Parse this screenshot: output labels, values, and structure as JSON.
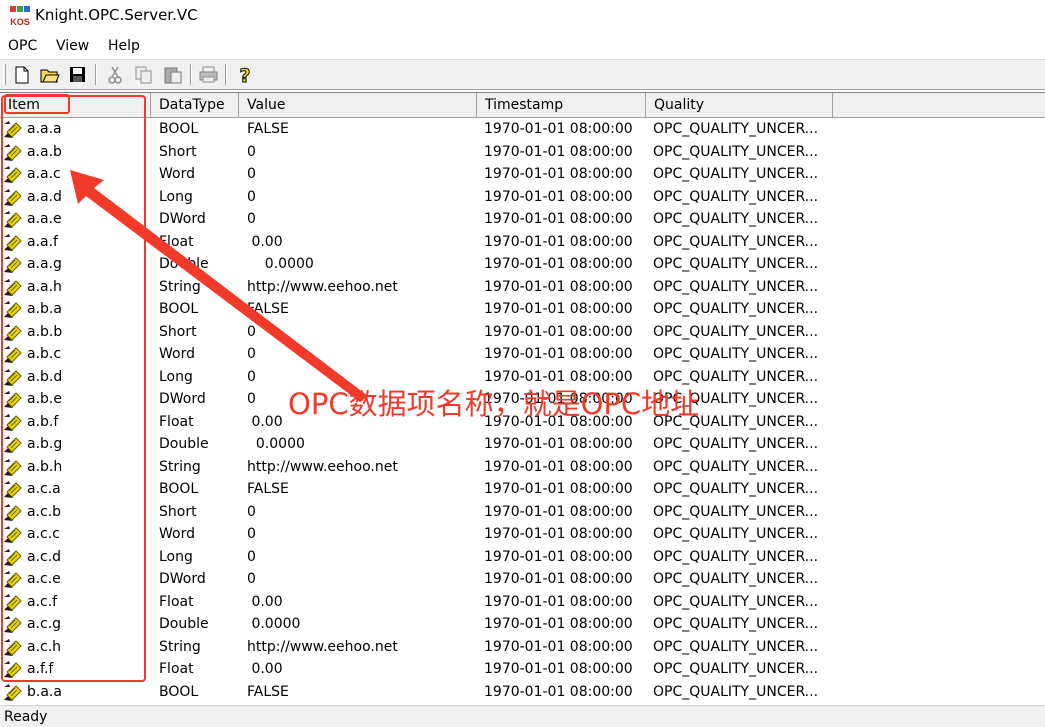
{
  "window": {
    "title": "Knight.OPC.Server.VC",
    "icon_label": "KOS"
  },
  "menu": {
    "items": [
      "OPC",
      "View",
      "Help"
    ]
  },
  "toolbar": {
    "buttons": [
      "new-file-icon",
      "open-folder-icon",
      "save-icon",
      "cut-icon",
      "copy-icon",
      "paste-icon",
      "print-icon",
      "help-icon"
    ]
  },
  "columns": [
    "Item",
    "DataType",
    "Value",
    "Timestamp",
    "Quality"
  ],
  "rows": [
    {
      "item": "a.a.a",
      "type": "BOOL",
      "value": "FALSE",
      "ts": "1970-01-01 08:00:00",
      "quality": "OPC_QUALITY_UNCER..."
    },
    {
      "item": "a.a.b",
      "type": "Short",
      "value": "0",
      "ts": "1970-01-01 08:00:00",
      "quality": "OPC_QUALITY_UNCER..."
    },
    {
      "item": "a.a.c",
      "type": "Word",
      "value": "0",
      "ts": "1970-01-01 08:00:00",
      "quality": "OPC_QUALITY_UNCER..."
    },
    {
      "item": "a.a.d",
      "type": "Long",
      "value": "0",
      "ts": "1970-01-01 08:00:00",
      "quality": "OPC_QUALITY_UNCER..."
    },
    {
      "item": "a.a.e",
      "type": "DWord",
      "value": "0",
      "ts": "1970-01-01 08:00:00",
      "quality": "OPC_QUALITY_UNCER..."
    },
    {
      "item": "a.a.f",
      "type": "Float",
      "value": " 0.00",
      "ts": "1970-01-01 08:00:00",
      "quality": "OPC_QUALITY_UNCER..."
    },
    {
      "item": "a.a.g",
      "type": "Double",
      "value": "    0.0000",
      "ts": "1970-01-01 08:00:00",
      "quality": "OPC_QUALITY_UNCER..."
    },
    {
      "item": "a.a.h",
      "type": "String",
      "value": "http://www.eehoo.net",
      "ts": "1970-01-01 08:00:00",
      "quality": "OPC_QUALITY_UNCER..."
    },
    {
      "item": "a.b.a",
      "type": "BOOL",
      "value": "FALSE",
      "ts": "1970-01-01 08:00:00",
      "quality": "OPC_QUALITY_UNCER..."
    },
    {
      "item": "a.b.b",
      "type": "Short",
      "value": "0",
      "ts": "1970-01-01 08:00:00",
      "quality": "OPC_QUALITY_UNCER..."
    },
    {
      "item": "a.b.c",
      "type": "Word",
      "value": "0",
      "ts": "1970-01-01 08:00:00",
      "quality": "OPC_QUALITY_UNCER..."
    },
    {
      "item": "a.b.d",
      "type": "Long",
      "value": "0",
      "ts": "1970-01-01 08:00:00",
      "quality": "OPC_QUALITY_UNCER..."
    },
    {
      "item": "a.b.e",
      "type": "DWord",
      "value": "0",
      "ts": "1970-01-01 08:00:00",
      "quality": "OPC_QUALITY_UNCER..."
    },
    {
      "item": "a.b.f",
      "type": "Float",
      "value": " 0.00",
      "ts": "1970-01-01 08:00:00",
      "quality": "OPC_QUALITY_UNCER..."
    },
    {
      "item": "a.b.g",
      "type": "Double",
      "value": "  0.0000",
      "ts": "1970-01-01 08:00:00",
      "quality": "OPC_QUALITY_UNCER..."
    },
    {
      "item": "a.b.h",
      "type": "String",
      "value": "http://www.eehoo.net",
      "ts": "1970-01-01 08:00:00",
      "quality": "OPC_QUALITY_UNCER..."
    },
    {
      "item": "a.c.a",
      "type": "BOOL",
      "value": "FALSE",
      "ts": "1970-01-01 08:00:00",
      "quality": "OPC_QUALITY_UNCER..."
    },
    {
      "item": "a.c.b",
      "type": "Short",
      "value": "0",
      "ts": "1970-01-01 08:00:00",
      "quality": "OPC_QUALITY_UNCER..."
    },
    {
      "item": "a.c.c",
      "type": "Word",
      "value": "0",
      "ts": "1970-01-01 08:00:00",
      "quality": "OPC_QUALITY_UNCER..."
    },
    {
      "item": "a.c.d",
      "type": "Long",
      "value": "0",
      "ts": "1970-01-01 08:00:00",
      "quality": "OPC_QUALITY_UNCER..."
    },
    {
      "item": "a.c.e",
      "type": "DWord",
      "value": "0",
      "ts": "1970-01-01 08:00:00",
      "quality": "OPC_QUALITY_UNCER..."
    },
    {
      "item": "a.c.f",
      "type": "Float",
      "value": " 0.00",
      "ts": "1970-01-01 08:00:00",
      "quality": "OPC_QUALITY_UNCER..."
    },
    {
      "item": "a.c.g",
      "type": "Double",
      "value": " 0.0000",
      "ts": "1970-01-01 08:00:00",
      "quality": "OPC_QUALITY_UNCER..."
    },
    {
      "item": "a.c.h",
      "type": "String",
      "value": "http://www.eehoo.net",
      "ts": "1970-01-01 08:00:00",
      "quality": "OPC_QUALITY_UNCER..."
    },
    {
      "item": "a.f.f",
      "type": "Float",
      "value": " 0.00",
      "ts": "1970-01-01 08:00:00",
      "quality": "OPC_QUALITY_UNCER..."
    },
    {
      "item": "b.a.a",
      "type": "BOOL",
      "value": "FALSE",
      "ts": "1970-01-01 08:00:00",
      "quality": "OPC_QUALITY_UNCER..."
    }
  ],
  "status": {
    "text": "Ready"
  },
  "annotation": {
    "text": "OPC数据项名称，就是OPC地址",
    "color": "#f23a2a"
  }
}
